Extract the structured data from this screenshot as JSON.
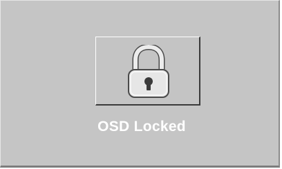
{
  "osd": {
    "status_text": "OSD Locked",
    "icon": "padlock-icon",
    "colors": {
      "background": "#c5c5c5",
      "text": "#ffffff",
      "panel_shadow": "#3a3a3a"
    }
  }
}
